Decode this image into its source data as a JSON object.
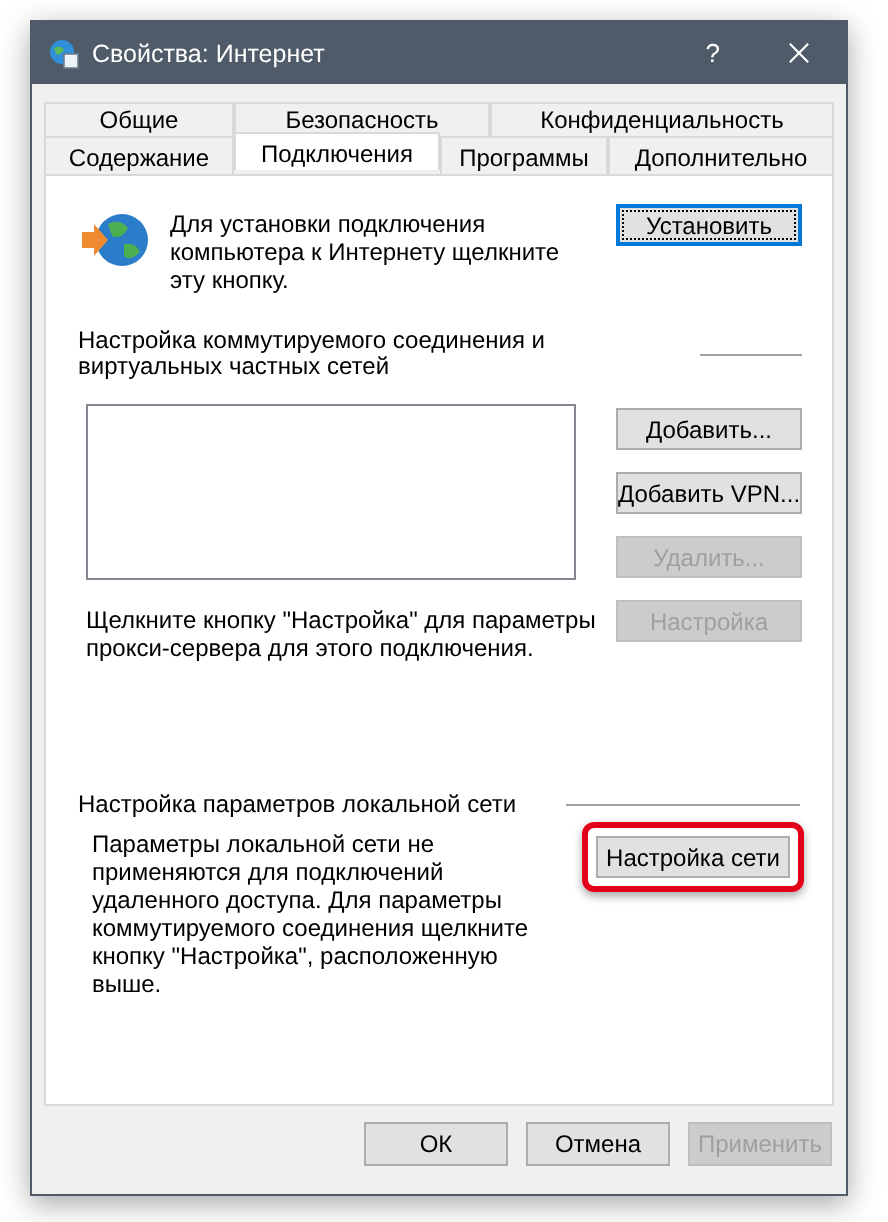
{
  "window": {
    "title": "Свойства: Интернет",
    "help": "?"
  },
  "tab_rows": [
    [
      {
        "label": "Общие",
        "selected": false
      },
      {
        "label": "Безопасность",
        "selected": false
      },
      {
        "label": "Конфиденциальность",
        "selected": false
      }
    ],
    [
      {
        "label": "Содержание",
        "selected": false
      },
      {
        "label": "Подключения",
        "selected": true
      },
      {
        "label": "Программы",
        "selected": false
      },
      {
        "label": "Дополнительно",
        "selected": false
      }
    ]
  ],
  "setup": {
    "text": "Для установки подключения компьютера к Интернету щелкните эту кнопку.",
    "button": {
      "label": "Установить",
      "focused": true
    }
  },
  "dialup": {
    "heading": "Настройка коммутируемого соединения и виртуальных частных сетей",
    "buttons": [
      {
        "label": "Добавить...",
        "disabled": false
      },
      {
        "label": "Добавить VPN...",
        "disabled": false
      },
      {
        "label": "Удалить...",
        "disabled": true
      },
      {
        "label": "Настройка",
        "disabled": true
      }
    ],
    "proxy_text": "Щелкните кнопку \"Настройка\" для параметры прокси-сервера для этого подключения."
  },
  "lan": {
    "heading": "Настройка параметров локальной сети",
    "text": "Параметры локальной сети не применяются для подключений удаленного доступа. Для параметры коммутируемого соединения щелкните кнопку \"Настройка\", расположенную выше.",
    "button": {
      "label": "Настройка сети",
      "highlighted": true
    }
  },
  "footer_buttons": [
    {
      "label": "ОК",
      "disabled": false
    },
    {
      "label": "Отмена",
      "disabled": false
    },
    {
      "label": "Применить",
      "disabled": true
    }
  ]
}
